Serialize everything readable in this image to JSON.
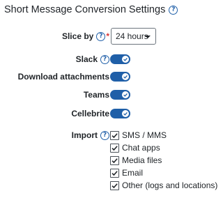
{
  "header": {
    "title": "Short Message Conversion Settings",
    "help_icon": "help-circle-icon"
  },
  "slice_by": {
    "label": "Slice by",
    "required_mark": "*",
    "value": "24 hours"
  },
  "toggles": [
    {
      "label": "Slack",
      "has_help": true,
      "on": true
    },
    {
      "label": "Download attachments",
      "has_help": false,
      "on": true
    },
    {
      "label": "Teams",
      "has_help": false,
      "on": true
    },
    {
      "label": "Cellebrite",
      "has_help": false,
      "on": true
    }
  ],
  "import": {
    "label": "Import",
    "options": [
      {
        "label": "SMS / MMS",
        "checked": true
      },
      {
        "label": "Chat apps",
        "checked": true
      },
      {
        "label": "Media files",
        "checked": true
      },
      {
        "label": "Email",
        "checked": true
      },
      {
        "label": "Other (logs and locations)",
        "checked": true
      }
    ]
  },
  "colors": {
    "accent": "#1f5fa8",
    "required": "#d93636",
    "text": "#212529"
  }
}
